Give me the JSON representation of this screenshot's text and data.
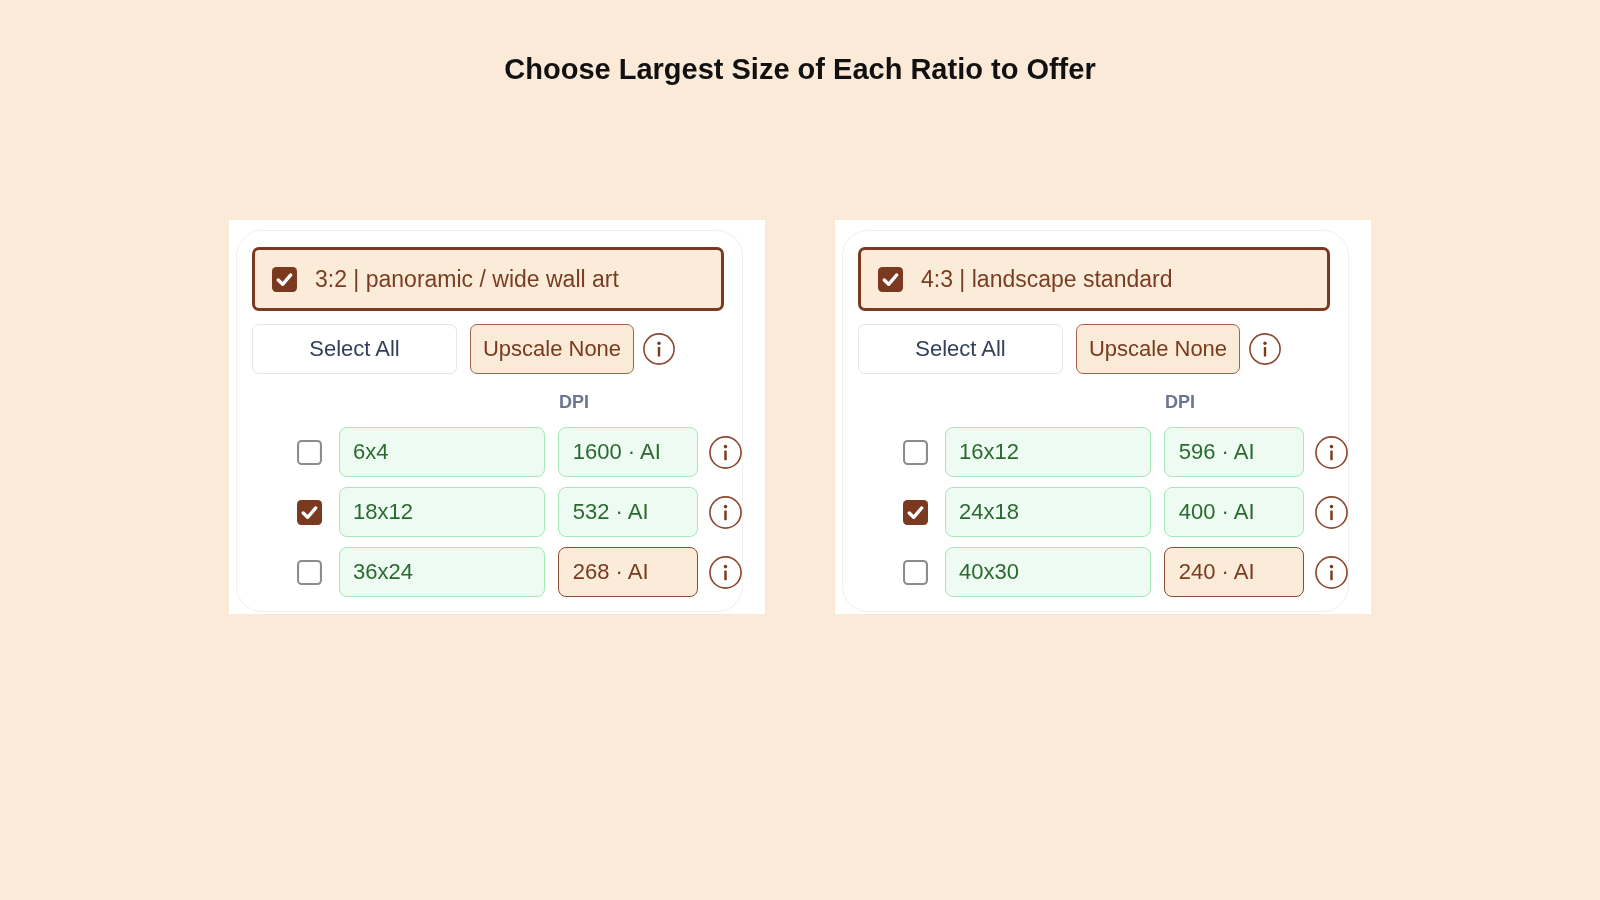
{
  "title": "Choose Largest Size of Each Ratio to Offer",
  "panels": [
    {
      "header": {
        "label": "3:2 | panoramic / wide wall art",
        "checked": true
      },
      "buttons": [
        {
          "label": "Select All",
          "kind": "outline"
        },
        {
          "label": "Upscale None",
          "kind": "filled"
        }
      ],
      "dpi_label": "DPI",
      "sizes": [
        {
          "checked": false,
          "size": "6x4",
          "dpi": "1600 · AI",
          "low_dpi": false
        },
        {
          "checked": true,
          "size": "18x12",
          "dpi": "532 · AI",
          "low_dpi": false
        },
        {
          "checked": false,
          "size": "36x24",
          "dpi": "268 · AI",
          "low_dpi": true
        }
      ]
    },
    {
      "header": {
        "label": "4:3 | landscape standard",
        "checked": true
      },
      "buttons": [
        {
          "label": "Select All",
          "kind": "outline"
        },
        {
          "label": "Upscale None",
          "kind": "filled"
        }
      ],
      "dpi_label": "DPI",
      "sizes": [
        {
          "checked": false,
          "size": "16x12",
          "dpi": "596 · AI",
          "low_dpi": false
        },
        {
          "checked": true,
          "size": "24x18",
          "dpi": "400 · AI",
          "low_dpi": false
        },
        {
          "checked": false,
          "size": "40x30",
          "dpi": "240 · AI",
          "low_dpi": true
        }
      ]
    }
  ]
}
